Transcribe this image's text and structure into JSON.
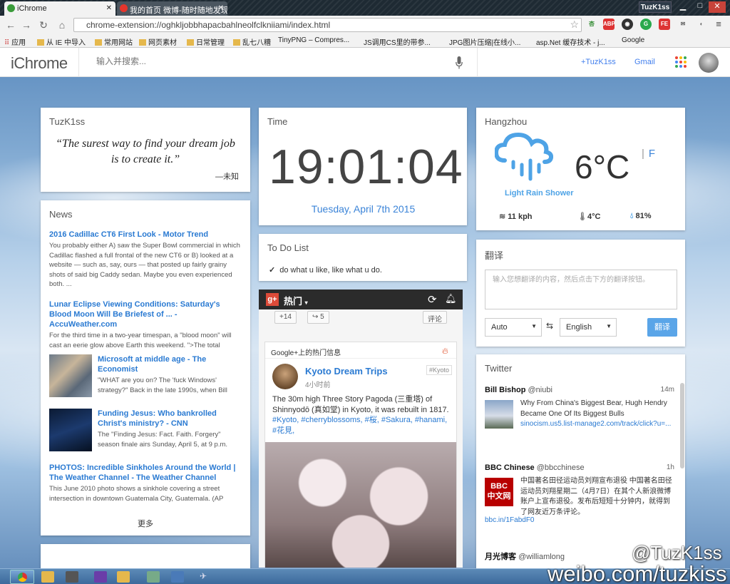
{
  "browser": {
    "tabs": [
      {
        "label": "iChrome",
        "active": true
      },
      {
        "label": "我的首页 微博-随时随地发现",
        "active": false
      }
    ],
    "window_user": "TuzK1ss",
    "url": "chrome-extension://oghkljobbhapacbahlneolfclkniiami/index.html",
    "bookmarks": [
      "应用",
      "从 IE 中导入",
      "常用网站",
      "网页素材",
      "日常管理",
      "乱七八糟",
      "TinyPNG – Compres...",
      "JS调用CS里的带参...",
      "JPG图片压缩|在线小...",
      "asp.Net 缓存技术 - j...",
      "Google"
    ],
    "extensions": [
      "杏",
      "ABP",
      "◉",
      "G",
      "FE",
      "✉",
      "◐",
      "≡"
    ]
  },
  "header": {
    "logo": "iChrome",
    "search_placeholder": "输入并搜索...",
    "links": [
      "+TuzK1ss",
      "Gmail"
    ]
  },
  "colors": {
    "accent": "#427fed",
    "link": "#2a7ad2",
    "weather": "#4ea3e6",
    "translate_btn": "#5aa5e8"
  },
  "quote_card": {
    "title": "TuzK1ss",
    "quote": "“The surest way to find your dream job is to create it.”",
    "author": "—未知"
  },
  "news": {
    "title": "News",
    "items": [
      {
        "title": "2016 Cadillac CT6 First Look - Motor Trend",
        "desc": "You probably either A) saw the Super Bowl commercial in which Cadillac flashed a full frontal of the new CT6 or B) looked at a website — such as, say, ours — that posted up fairly grainy shots of said big Caddy sedan. Maybe you even experienced both. ..."
      },
      {
        "title": "Lunar Eclipse Viewing Conditions: Saturday's Blood Moon Will Be Briefest of ... - AccuWeather.com",
        "desc": "For the third time in a two-year timespan, a \"blood moon\" will cast an eerie glow above Earth this weekend. \">The total"
      },
      {
        "title": "Microsoft at middle age - The Economist",
        "desc": "\"WHAT are you on? The 'fuck Windows' strategy?\" Back in the late 1990s, when Bill"
      },
      {
        "title": "Funding Jesus: Who bankrolled Christ's ministry? - CNN",
        "desc": "The \"Finding Jesus: Fact. Faith. Forgery\" season finale airs Sunday, April 5, at 9 p.m."
      },
      {
        "title": "PHOTOS: Incredible Sinkholes Around the World | The Weather Channel - The Weather Channel",
        "desc": "This June 2010 photo shows a sinkhole covering a street intersection in downtown Guatemala City, Guatemala. (AP"
      }
    ],
    "more": "更多"
  },
  "time_card": {
    "title": "Time",
    "clock": "19:01:04",
    "date": "Tuesday, April 7th 2015"
  },
  "todo": {
    "title": "To Do List",
    "items": [
      "do what u like, like what u do."
    ]
  },
  "gplus": {
    "label": "热门",
    "counts": [
      "+14",
      "5"
    ],
    "comment": "评论",
    "section": "Google+上的热门信息",
    "post": {
      "author": "Kyoto Dream Trips",
      "time": "4小时前",
      "tag": "#Kyoto",
      "text": "The 30m high Three Story Pagoda (三重塔) of Shinnyodō (真如堂) in Kyoto, it was rebuilt in 1817.",
      "hashtags": "#Kyoto, #cherryblossoms, #桜, #Sakura, #hanami, #花見,"
    }
  },
  "weather": {
    "city": "Hangzhou",
    "temp": "6°C",
    "units_sep": "|",
    "unit_alt": "F",
    "desc": "Light Rain Shower",
    "wind": "11 kph",
    "feels": "4°C",
    "humidity": "81%"
  },
  "translate": {
    "title": "翻译",
    "placeholder": "输入您想翻译的内容，然后点击下方的翻译按钮。",
    "from": "Auto",
    "to": "English",
    "button": "翻译"
  },
  "twitter": {
    "title": "Twitter",
    "tweets": [
      {
        "name": "Bill Bishop",
        "handle": "@niubi",
        "time": "14m",
        "text": "Why From China's Biggest Bear, Hugh Hendry Became One Of Its Biggest Bulls",
        "link": "sinocism.us5.list-manage2.com/track/click?u=..."
      },
      {
        "name": "BBC Chinese",
        "handle": "@bbcchinese",
        "time": "1h",
        "text": "中国著名田径运动员刘翔宣布退役 中国著名田径运动员刘翔星期二（4月7日）在其个人新浪微博账户上宣布退役。发布后短短十分钟内，就得到了网友近万条评论。",
        "link": "bbc.in/1FabdF0"
      },
      {
        "name": "月光博客",
        "handle": "@williamlong",
        "time": "",
        "text": "",
        "link": ""
      }
    ]
  },
  "watermark": {
    "line1": "@TuzK1ss",
    "line2": "weibo.com/tuzkiss"
  }
}
